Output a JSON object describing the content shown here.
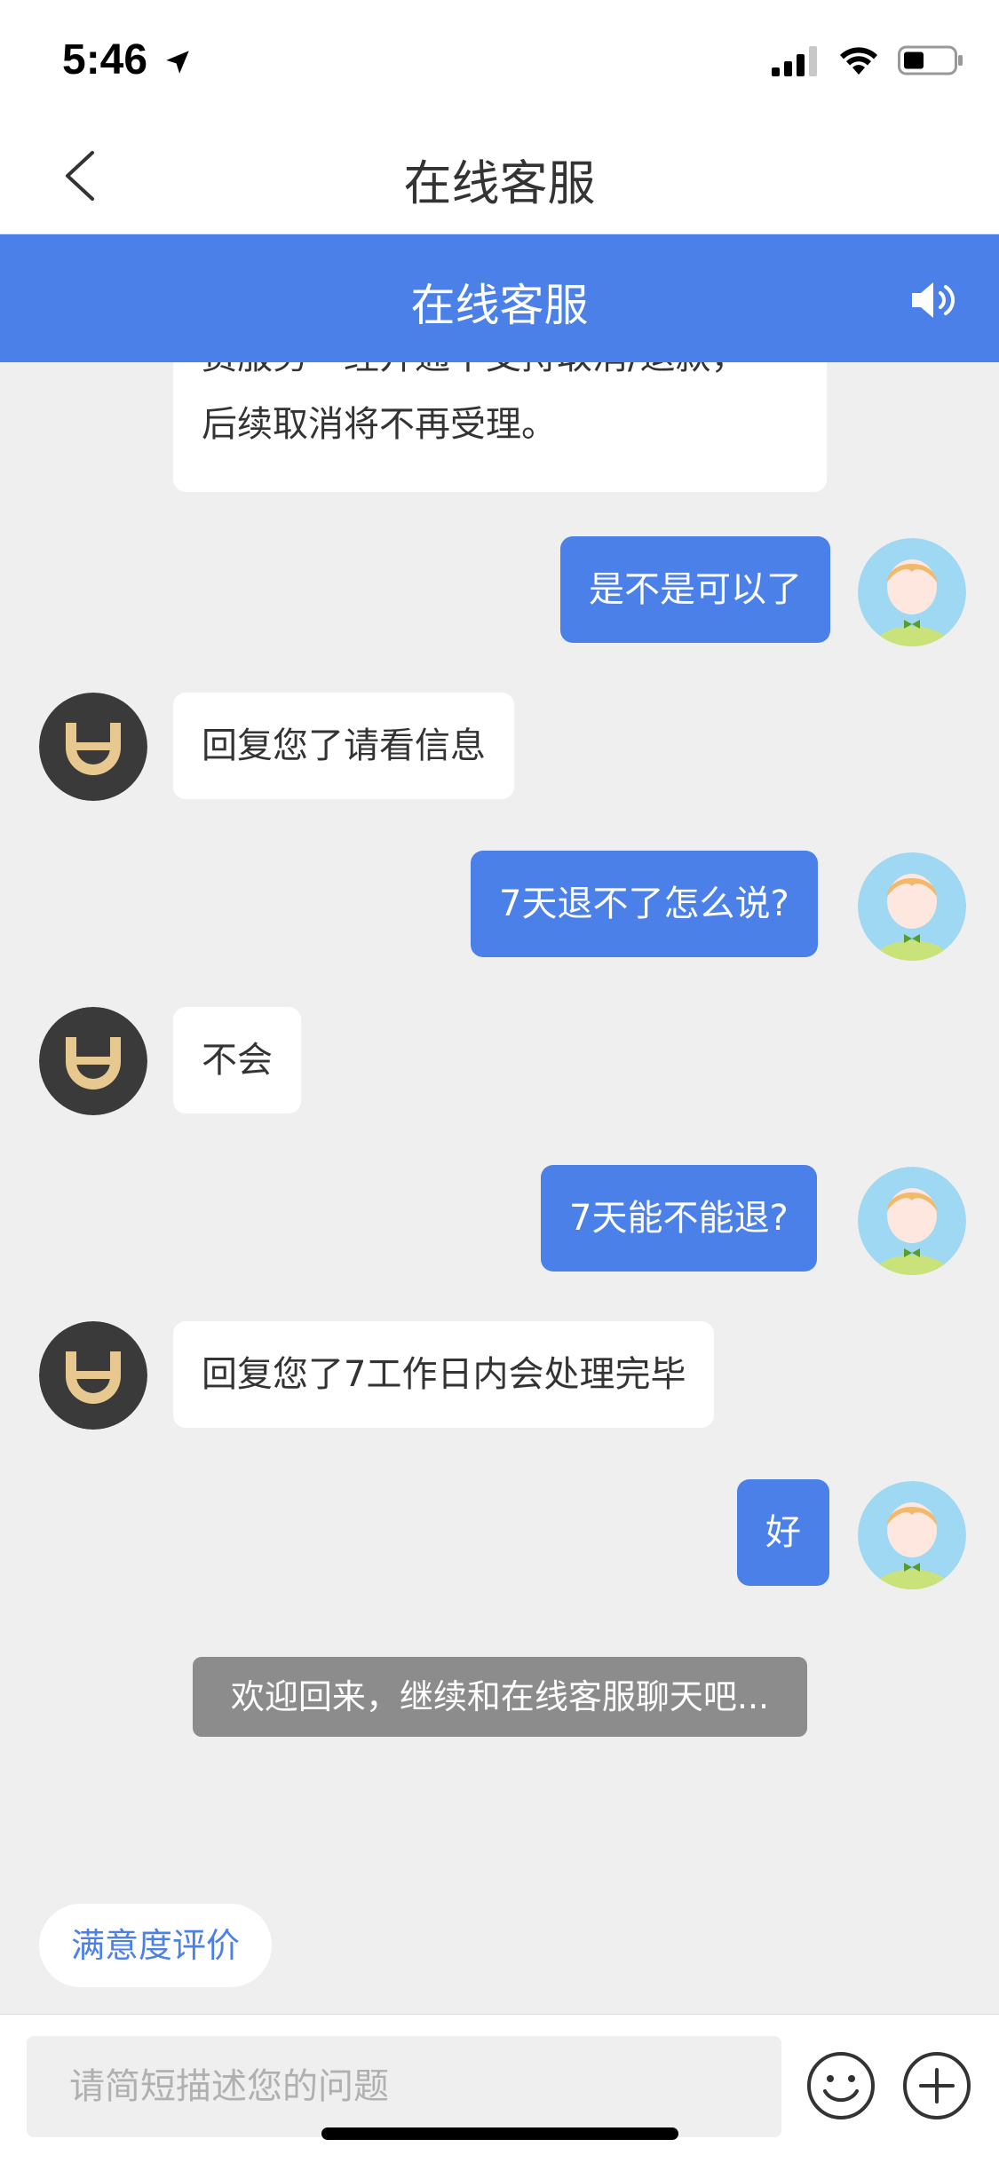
{
  "status_bar": {
    "time": "5:46"
  },
  "nav": {
    "title": "在线客服"
  },
  "chat_header": {
    "title": "在线客服"
  },
  "messages": [
    {
      "side": "left",
      "line1": "费服务一经开通不支持取消/退款，",
      "line2": "后续取消将不再受理。"
    },
    {
      "side": "right",
      "text": "是不是可以了"
    },
    {
      "side": "left",
      "text": "回复您了请看信息"
    },
    {
      "side": "right",
      "text": "7天退不了怎么说?"
    },
    {
      "side": "left",
      "text": "不会"
    },
    {
      "side": "right",
      "text": "7天能不能退?"
    },
    {
      "side": "left",
      "text": "回复您了7工作日内会处理完毕"
    },
    {
      "side": "right",
      "text": "好"
    }
  ],
  "system_note": "欢迎回来，继续和在线客服聊天吧...",
  "rating_button": "满意度评价",
  "input": {
    "placeholder": "请简短描述您的问题"
  },
  "colors": {
    "accent": "#4a80e8",
    "background": "#efefef",
    "agent_avatar_bg": "#3a3a3a",
    "agent_logo": "#e7c98f"
  }
}
